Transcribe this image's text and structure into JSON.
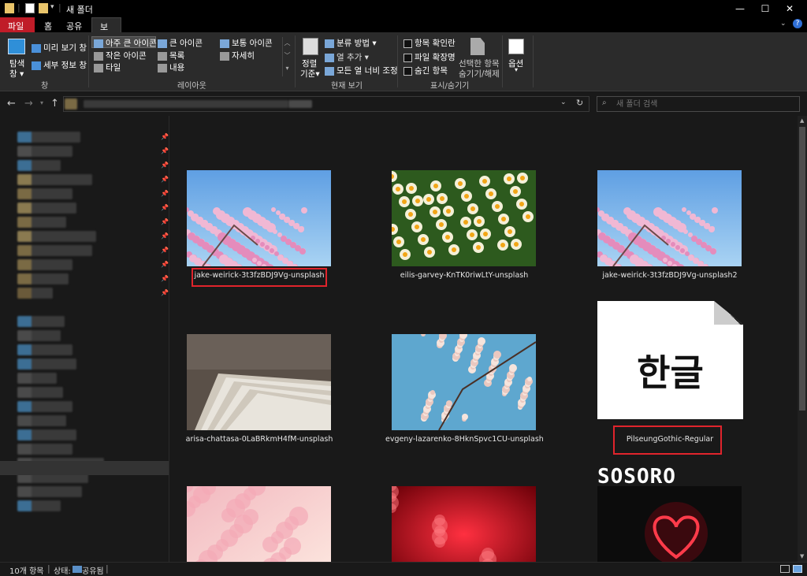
{
  "window": {
    "title": "새 폴더",
    "minimize": "—",
    "maximize": "☐",
    "close": "✕"
  },
  "tabs": {
    "file": "파일",
    "home": "홈",
    "share": "공유",
    "view": "보기"
  },
  "ribbon": {
    "pane": {
      "nav_pane_line1": "탐색",
      "nav_pane_line2": "창",
      "preview": "미리 보기 창",
      "details": "세부 정보 창",
      "group": "창"
    },
    "layout": {
      "xlarge": "아주 큰 아이콘",
      "large": "큰 아이콘",
      "medium": "보통 아이콘",
      "small": "작은 아이콘",
      "list": "목록",
      "details": "자세히",
      "tiles": "타일",
      "content": "내용",
      "group": "레이아웃"
    },
    "current": {
      "sort_line1": "정렬",
      "sort_line2": "기준",
      "group_by": "분류 방법",
      "add_col": "열 추가",
      "fit_cols": "모든 열 너비 조정",
      "group": "현재 보기"
    },
    "showhide": {
      "checkboxes": "항목 확인란",
      "extensions": "파일 확장명",
      "hidden": "숨긴 항목",
      "hide_sel_line1": "선택한 항목",
      "hide_sel_line2": "숨기기/해제",
      "group": "표시/숨기기"
    },
    "options": "옵션"
  },
  "search": {
    "placeholder": "새 폴더 검색"
  },
  "files": [
    {
      "name": "jake-weirick-3t3fzBDJ9Vg-unsplash",
      "kind": "cherry"
    },
    {
      "name": "eilis-garvey-KnTK0riwLtY-unsplash",
      "kind": "daffodil"
    },
    {
      "name": "jake-weirick-3t3fzBDJ9Vg-unsplash2",
      "kind": "cherry"
    },
    {
      "name": "arisa-chattasa-0LaBRkmH4fM-unsplash",
      "kind": "papers"
    },
    {
      "name": "evgeny-lazarenko-8HknSpvc1CU-unsplash",
      "kind": "blossom"
    },
    {
      "name": "PilseungGothic-Regular",
      "kind": "font",
      "glyph": "한글"
    },
    {
      "name": "",
      "kind": "pink"
    },
    {
      "name": "",
      "kind": "red"
    },
    {
      "name": "",
      "kind": "heart"
    }
  ],
  "watermark": "SOSORO",
  "status": {
    "count": "10개 항목",
    "state_label": "상태:",
    "state_value": "공유됨"
  },
  "colors": {
    "accent_red": "#e0242c",
    "file_tab": "#c01c28"
  }
}
